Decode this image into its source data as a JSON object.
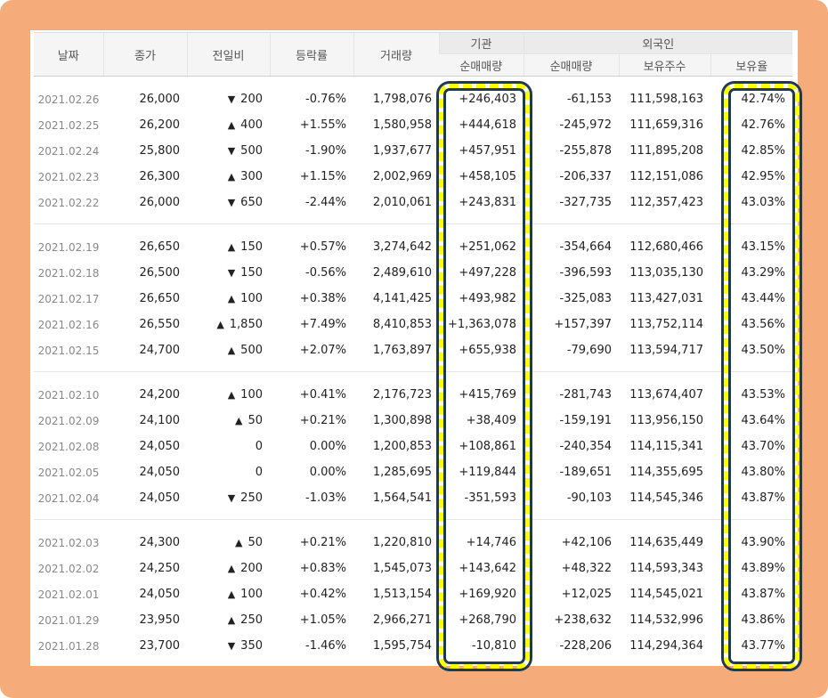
{
  "headers": {
    "date": "날짜",
    "close": "종가",
    "change": "전일비",
    "rate": "등락률",
    "volume": "거래량",
    "institution": "기관",
    "inst_net": "순매매량",
    "foreign": "외국인",
    "for_net": "순매매량",
    "holdings": "보유주수",
    "ratio": "보유율"
  },
  "colors": {
    "frame": "#f5ac7a",
    "up": "#d4000a",
    "down": "#1860d4",
    "highlight": "#ffff00"
  },
  "rows": [
    {
      "date": "2021.02.26",
      "close": "26,000",
      "dir": "down",
      "change": "200",
      "rate": "-0.76%",
      "volume": "1,798,076",
      "inst": "+246,403",
      "foreign": "-61,153",
      "holdings": "111,598,163",
      "ratio": "42.74%"
    },
    {
      "date": "2021.02.25",
      "close": "26,200",
      "dir": "up",
      "change": "400",
      "rate": "+1.55%",
      "volume": "1,580,958",
      "inst": "+444,618",
      "foreign": "-245,972",
      "holdings": "111,659,316",
      "ratio": "42.76%"
    },
    {
      "date": "2021.02.24",
      "close": "25,800",
      "dir": "down",
      "change": "500",
      "rate": "-1.90%",
      "volume": "1,937,677",
      "inst": "+457,951",
      "foreign": "-255,878",
      "holdings": "111,895,208",
      "ratio": "42.85%"
    },
    {
      "date": "2021.02.23",
      "close": "26,300",
      "dir": "up",
      "change": "300",
      "rate": "+1.15%",
      "volume": "2,002,969",
      "inst": "+458,105",
      "foreign": "-206,337",
      "holdings": "112,151,086",
      "ratio": "42.95%"
    },
    {
      "date": "2021.02.22",
      "close": "26,000",
      "dir": "down",
      "change": "650",
      "rate": "-2.44%",
      "volume": "2,010,061",
      "inst": "+243,831",
      "foreign": "-327,735",
      "holdings": "112,357,423",
      "ratio": "43.03%"
    },
    {
      "date": "2021.02.19",
      "close": "26,650",
      "dir": "up",
      "change": "150",
      "rate": "+0.57%",
      "volume": "3,274,642",
      "inst": "+251,062",
      "foreign": "-354,664",
      "holdings": "112,680,466",
      "ratio": "43.15%"
    },
    {
      "date": "2021.02.18",
      "close": "26,500",
      "dir": "down",
      "change": "150",
      "rate": "-0.56%",
      "volume": "2,489,610",
      "inst": "+497,228",
      "foreign": "-396,593",
      "holdings": "113,035,130",
      "ratio": "43.29%"
    },
    {
      "date": "2021.02.17",
      "close": "26,650",
      "dir": "up",
      "change": "100",
      "rate": "+0.38%",
      "volume": "4,141,425",
      "inst": "+493,982",
      "foreign": "-325,083",
      "holdings": "113,427,031",
      "ratio": "43.44%"
    },
    {
      "date": "2021.02.16",
      "close": "26,550",
      "dir": "up",
      "change": "1,850",
      "rate": "+7.49%",
      "volume": "8,410,853",
      "inst": "+1,363,078",
      "foreign": "+157,397",
      "holdings": "113,752,114",
      "ratio": "43.56%"
    },
    {
      "date": "2021.02.15",
      "close": "24,700",
      "dir": "up",
      "change": "500",
      "rate": "+2.07%",
      "volume": "1,763,897",
      "inst": "+655,938",
      "foreign": "-79,690",
      "holdings": "113,594,717",
      "ratio": "43.50%"
    },
    {
      "date": "2021.02.10",
      "close": "24,200",
      "dir": "up",
      "change": "100",
      "rate": "+0.41%",
      "volume": "2,176,723",
      "inst": "+415,769",
      "foreign": "-281,743",
      "holdings": "113,674,407",
      "ratio": "43.53%"
    },
    {
      "date": "2021.02.09",
      "close": "24,100",
      "dir": "up",
      "change": "50",
      "rate": "+0.21%",
      "volume": "1,300,898",
      "inst": "+38,409",
      "foreign": "-159,191",
      "holdings": "113,956,150",
      "ratio": "43.64%"
    },
    {
      "date": "2021.02.08",
      "close": "24,050",
      "dir": "none",
      "change": "0",
      "rate": "0.00%",
      "volume": "1,200,853",
      "inst": "+108,861",
      "foreign": "-240,354",
      "holdings": "114,115,341",
      "ratio": "43.70%"
    },
    {
      "date": "2021.02.05",
      "close": "24,050",
      "dir": "none",
      "change": "0",
      "rate": "0.00%",
      "volume": "1,285,695",
      "inst": "+119,844",
      "foreign": "-189,651",
      "holdings": "114,355,695",
      "ratio": "43.80%"
    },
    {
      "date": "2021.02.04",
      "close": "24,050",
      "dir": "down",
      "change": "250",
      "rate": "-1.03%",
      "volume": "1,564,541",
      "inst": "-351,593",
      "foreign": "-90,103",
      "holdings": "114,545,346",
      "ratio": "43.87%"
    },
    {
      "date": "2021.02.03",
      "close": "24,300",
      "dir": "up",
      "change": "50",
      "rate": "+0.21%",
      "volume": "1,220,810",
      "inst": "+14,746",
      "foreign": "+42,106",
      "holdings": "114,635,449",
      "ratio": "43.90%"
    },
    {
      "date": "2021.02.02",
      "close": "24,250",
      "dir": "up",
      "change": "200",
      "rate": "+0.83%",
      "volume": "1,545,073",
      "inst": "+143,642",
      "foreign": "+48,322",
      "holdings": "114,593,343",
      "ratio": "43.89%"
    },
    {
      "date": "2021.02.01",
      "close": "24,050",
      "dir": "up",
      "change": "100",
      "rate": "+0.42%",
      "volume": "1,513,154",
      "inst": "+169,920",
      "foreign": "+12,025",
      "holdings": "114,545,021",
      "ratio": "43.87%"
    },
    {
      "date": "2021.01.29",
      "close": "23,950",
      "dir": "up",
      "change": "250",
      "rate": "+1.05%",
      "volume": "2,966,271",
      "inst": "+268,790",
      "foreign": "+238,632",
      "holdings": "114,532,996",
      "ratio": "43.86%"
    },
    {
      "date": "2021.01.28",
      "close": "23,700",
      "dir": "down",
      "change": "350",
      "rate": "-1.46%",
      "volume": "1,595,754",
      "inst": "-10,810",
      "foreign": "-228,206",
      "holdings": "114,294,364",
      "ratio": "43.77%"
    }
  ]
}
